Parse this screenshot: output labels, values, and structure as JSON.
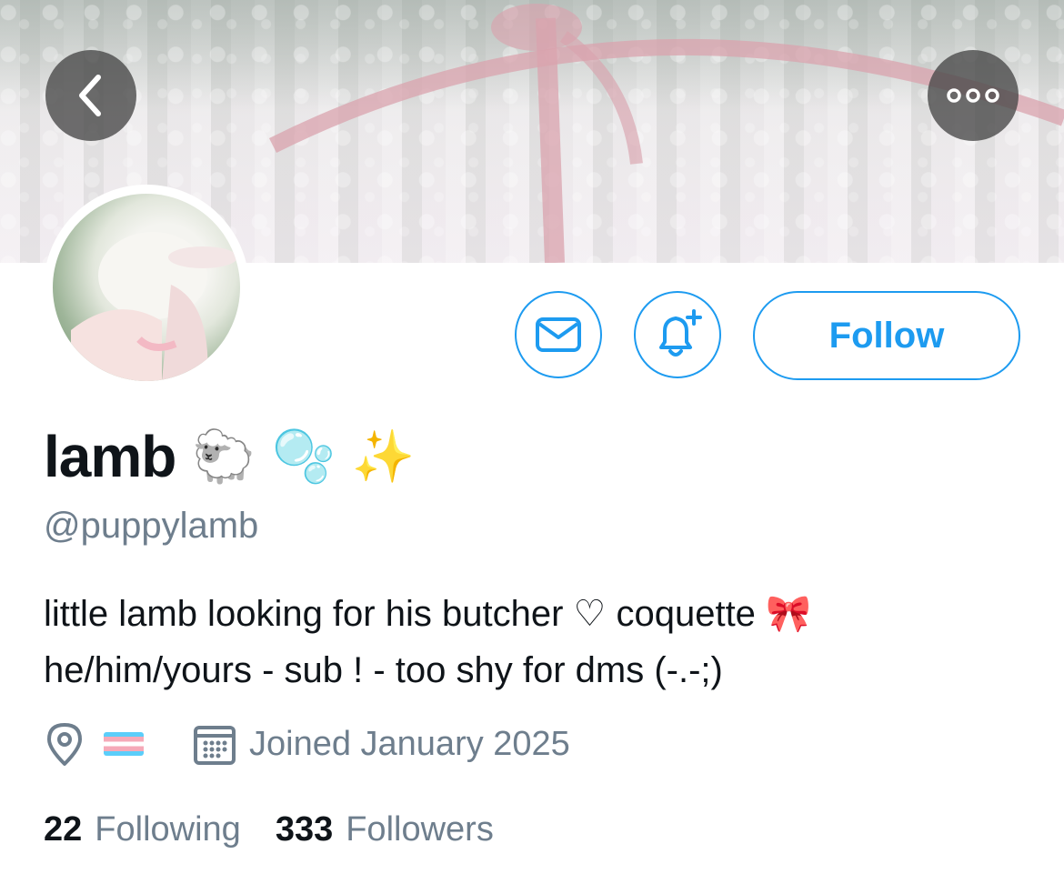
{
  "header": {
    "back_icon": "chevron-left-icon",
    "more_icon": "more-horizontal-icon"
  },
  "profile": {
    "display_name": "lamb",
    "name_emojis": [
      "🐑",
      "🫧",
      "✨"
    ],
    "handle": "@puppylamb",
    "bio_lines": [
      "little lamb looking for his butcher ♡ coquette 🎀",
      "he/him/yours - sub ! - too shy for dms (-.-;)"
    ],
    "location_flag": "transgender-flag",
    "joined": "Joined January 2025",
    "following_count": "22",
    "following_label": "Following",
    "followers_count": "333",
    "followers_label": "Followers"
  },
  "actions": {
    "follow_label": "Follow",
    "message_icon": "mail-icon",
    "notify_icon": "bell-plus-icon"
  },
  "colors": {
    "accent": "#1d9bf0",
    "secondary_text": "#6e7e8d",
    "primary_text": "#0f1419"
  }
}
